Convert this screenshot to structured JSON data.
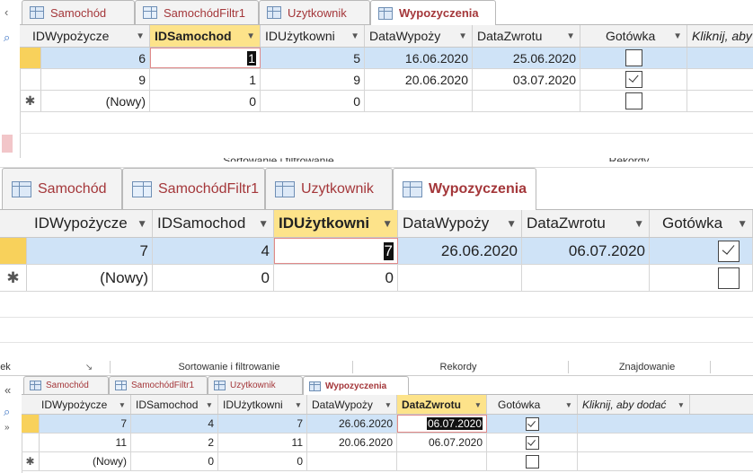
{
  "tabs": [
    "Samochód",
    "SamochódFiltr1",
    "Uzytkownik",
    "Wypozyczenia"
  ],
  "new_row_label": "(Nowy)",
  "ribbon": {
    "sort_filter": "Sortowanie i filtrowanie",
    "records": "Rekordy",
    "find": "Znajdowanie",
    "left_cut": "ek",
    "launcher_glyph": "↘"
  },
  "side_glyphs": {
    "collapse": "«",
    "search": "⌕",
    "collapse2": "»",
    "left_arrow": "‹"
  },
  "views": [
    {
      "filtered_column": "IDSamochod",
      "headers": [
        "IDWypożycze",
        "IDSamochod",
        "IDUżytkowni",
        "DataWypoży",
        "DataZwrotu",
        "Gotówka",
        "Kliknij, aby"
      ],
      "rows": [
        {
          "cells": [
            "6",
            "1",
            "5",
            "16.06.2020",
            "25.06.2020"
          ],
          "gotowka": false,
          "selected": true,
          "editing": "1"
        },
        {
          "cells": [
            "9",
            "1",
            "9",
            "20.06.2020",
            "03.07.2020"
          ],
          "gotowka": true,
          "selected": false,
          "editing": ""
        }
      ],
      "new_row": [
        "0",
        "0"
      ]
    },
    {
      "filtered_column": "IDUżytkowni",
      "headers": [
        "IDWypożycze",
        "IDSamochod",
        "IDUżytkowni",
        "DataWypoży",
        "DataZwrotu",
        "Gotówka"
      ],
      "rows": [
        {
          "cells": [
            "7",
            "4",
            "7",
            "26.06.2020",
            "06.07.2020"
          ],
          "gotowka": true,
          "selected": true,
          "editing": "7"
        }
      ],
      "new_row": [
        "0",
        "0"
      ]
    },
    {
      "filtered_column": "DataZwrotu",
      "headers": [
        "IDWypożycze",
        "IDSamochod",
        "IDUżytkowni",
        "DataWypoży",
        "DataZwrotu",
        "Gotówka",
        "Kliknij, aby dodać"
      ],
      "rows": [
        {
          "cells": [
            "7",
            "4",
            "7",
            "26.06.2020",
            "06.07.2020"
          ],
          "gotowka": true,
          "selected": true,
          "editing": "06.07.2020"
        },
        {
          "cells": [
            "11",
            "2",
            "11",
            "20.06.2020",
            "06.07.2020"
          ],
          "gotowka": true,
          "selected": false,
          "editing": ""
        }
      ],
      "new_row": [
        "0",
        "0"
      ]
    }
  ],
  "colors": {
    "tab_text": "#a4373a",
    "selected_row": "#cfe3f7",
    "filter_header": "#fde38a",
    "current_selector": "#f8d15b"
  }
}
